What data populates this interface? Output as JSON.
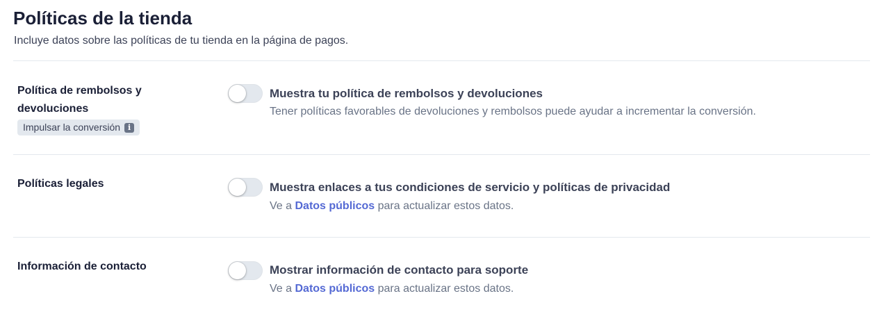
{
  "header": {
    "title": "Políticas de la tienda",
    "subtitle": "Incluye datos sobre las políticas de tu tienda en la página de pagos."
  },
  "policies": [
    {
      "label": "Política de rembolsos y devoluciones",
      "badge": "Impulsar la conversión",
      "badge_icon": "info-icon",
      "toggle_on": false,
      "title": "Muestra tu política de rembolsos y devoluciones",
      "description": "Tener políticas favorables de devoluciones y rembolsos puede ayudar a incrementar la conversión."
    },
    {
      "label": "Políticas legales",
      "toggle_on": false,
      "title": "Muestra enlaces a tus condiciones de servicio y políticas de privacidad",
      "desc_prefix": "Ve a ",
      "desc_link": "Datos públicos",
      "desc_suffix": " para actualizar estos datos."
    },
    {
      "label": "Información de contacto",
      "toggle_on": false,
      "title": "Mostrar información de contacto para soporte",
      "desc_prefix": "Ve a ",
      "desc_link": "Datos públicos",
      "desc_suffix": " para actualizar estos datos."
    }
  ],
  "colors": {
    "link": "#5469d4",
    "toggle_off_track": "#e3e8ee",
    "divider": "#e3e8ee",
    "badge_bg": "#e3e8ee"
  }
}
